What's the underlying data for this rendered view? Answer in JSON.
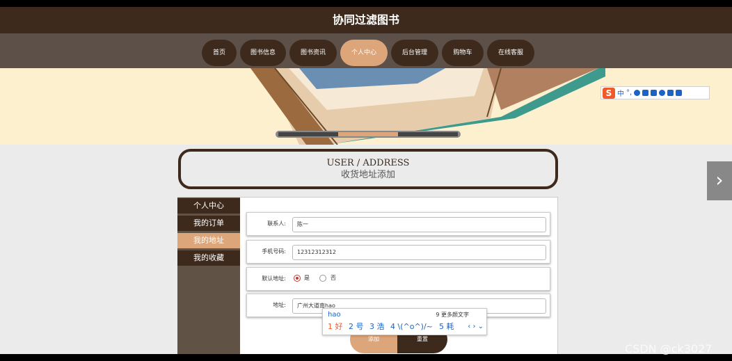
{
  "site": {
    "title": "协同过滤图书"
  },
  "nav": [
    {
      "label": "首页"
    },
    {
      "label": "图书信息"
    },
    {
      "label": "图书资讯"
    },
    {
      "label": "个人中心",
      "active": true
    },
    {
      "label": "后台管理"
    },
    {
      "label": "购物车"
    },
    {
      "label": "在线客服"
    }
  ],
  "ime_toolbar": {
    "lang": "中",
    "punct": "°,"
  },
  "section": {
    "title_en": "USER / ADDRESS",
    "title_cn": "收货地址添加"
  },
  "sidebar": [
    {
      "label": "个人中心"
    },
    {
      "label": "我的订单"
    },
    {
      "label": "我的地址",
      "active": true
    },
    {
      "label": "我的收藏"
    }
  ],
  "form": {
    "contact": {
      "label": "联系人:",
      "value": "陈一"
    },
    "phone": {
      "label": "手机号码:",
      "value": "12312312312"
    },
    "default": {
      "label": "默认地址:",
      "yes": "是",
      "no": "否",
      "selected": "是"
    },
    "address": {
      "label": "地址:",
      "value": "广州大道南hao"
    }
  },
  "ime_popup": {
    "composition": "hao",
    "more": "9 更多颜文字",
    "candidates": [
      "1 好",
      "2 号",
      "3 浩",
      "4 \\(^o^)/~",
      "5 耗"
    ],
    "pager": "‹ › ⌄"
  },
  "buttons": {
    "submit": "添加",
    "reset": "重置"
  },
  "watermark": "CSDN @ck3027",
  "colors": {
    "brand_dark": "#3d2a1c",
    "accent": "#dda57a",
    "nav_bg": "#5c5048"
  }
}
